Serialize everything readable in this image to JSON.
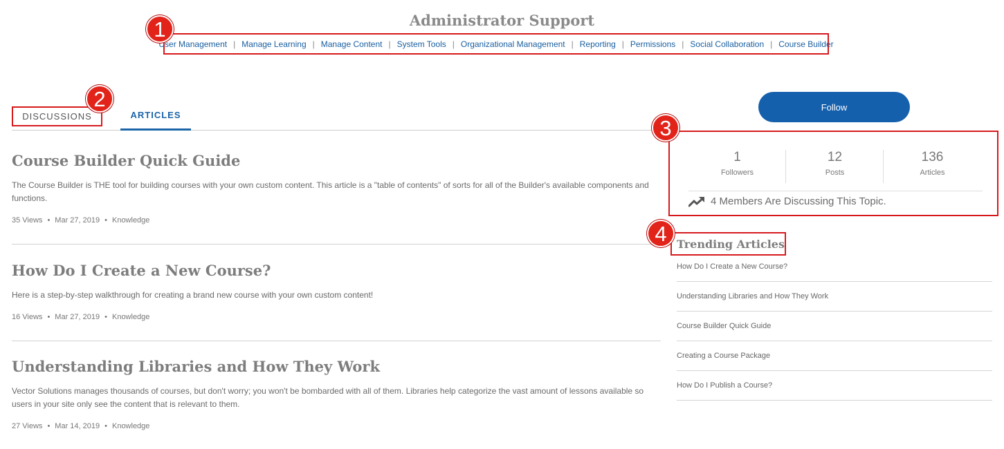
{
  "header": {
    "title": "Administrator Support"
  },
  "nav": {
    "items": [
      "User Management",
      "Manage Learning",
      "Manage Content",
      "System Tools",
      "Organizational Management",
      "Reporting",
      "Permissions",
      "Social Collaboration",
      "Course Builder"
    ],
    "separator": "|"
  },
  "callouts": [
    "1",
    "2",
    "3",
    "4"
  ],
  "tabs": {
    "discussions": "DISCUSSIONS",
    "articles": "ARTICLES"
  },
  "articles": [
    {
      "title": "Course Builder Quick Guide",
      "summary": "The Course Builder is THE tool for building courses with your own custom content. This article is a \"table of contents\" of sorts for all of the Builder's available components and functions.",
      "views": "35 Views",
      "date": "Mar 27, 2019",
      "category": "Knowledge"
    },
    {
      "title": "How Do I Create a New Course?",
      "summary": "Here is a step-by-step walkthrough for creating a brand new course with your own custom content!",
      "views": "16 Views",
      "date": "Mar 27, 2019",
      "category": "Knowledge"
    },
    {
      "title": "Understanding Libraries and How They Work",
      "summary": "Vector Solutions manages thousands of courses, but don't worry; you won't be bombarded with all of them. Libraries help categorize the vast amount of lessons available so users in your site only see the content that is relevant to them.",
      "views": "27 Views",
      "date": "Mar 14, 2019",
      "category": "Knowledge"
    }
  ],
  "meta_separator": "•",
  "sidebar": {
    "follow_label": "Follow",
    "stats": [
      {
        "value": "1",
        "label": "Followers"
      },
      {
        "value": "12",
        "label": "Posts"
      },
      {
        "value": "136",
        "label": "Articles"
      }
    ],
    "discussing_text": "4 Members Are Discussing This Topic.",
    "discussing_icon": "trending-up-icon",
    "trending_title": "Trending Articles",
    "trending": [
      "How Do I Create a New Course?",
      "Understanding Libraries and How They Work",
      "Course Builder Quick Guide",
      "Creating a Course Package",
      "How Do I Publish a Course?"
    ]
  },
  "colors": {
    "accent": "#1560ad",
    "callout": "#e2231a",
    "highlight_border": "#d7191c"
  }
}
